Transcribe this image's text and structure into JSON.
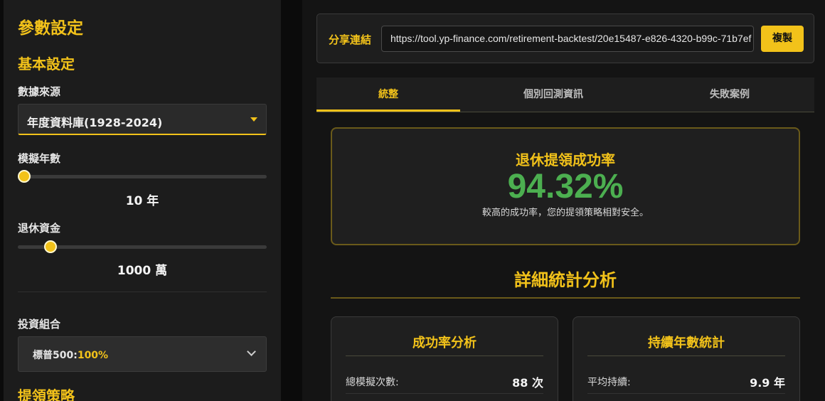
{
  "sidebar": {
    "title": "參數設定",
    "basic_heading": "基本設定",
    "data_source": {
      "label": "數據來源",
      "value": "年度資料庫(1928-2024)"
    },
    "years": {
      "label": "模擬年數",
      "value_text": "10 年",
      "fraction": 0.0
    },
    "capital": {
      "label": "退休資金",
      "value_text": "1000 萬",
      "fraction": 0.11
    },
    "portfolio": {
      "label": "投資組合",
      "name": "標普500:",
      "pct": "100%"
    },
    "strategy_heading": "提領策略"
  },
  "share": {
    "label": "分享連結",
    "url": "https://tool.yp-finance.com/retirement-backtest/20e15487-e826-4320-b99c-71b7ef",
    "copy_label": "複製"
  },
  "tabs": [
    {
      "label": "統整",
      "active": true
    },
    {
      "label": "個別回測資訊",
      "active": false
    },
    {
      "label": "失敗案例",
      "active": false
    }
  ],
  "summary": {
    "title": "退休提領成功率",
    "rate": "94.32%",
    "note": "較高的成功率，您的提領策略相對安全。"
  },
  "detail": {
    "title": "詳細統計分析",
    "cards": [
      {
        "title": "成功率分析",
        "row_key": "總模擬次數:",
        "row_value": "88 次"
      },
      {
        "title": "持續年數統計",
        "row_key": "平均持續:",
        "row_value": "9.9 年"
      }
    ]
  },
  "colors": {
    "accent": "#f2c21a",
    "success": "#4caf50",
    "background": "#0b0b0b",
    "panel": "#1c1c1c"
  }
}
